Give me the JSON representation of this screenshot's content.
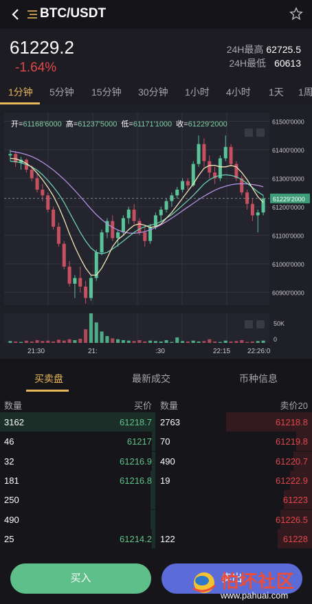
{
  "header": {
    "title": "BTC/USDT"
  },
  "ticker": {
    "last_price": "61229.2",
    "change_pct": "-1.64%",
    "high_label": "24H最高",
    "high_value": "62725.5",
    "low_label": "24H最低",
    "low_value": "60613"
  },
  "timeframes": [
    {
      "label": "1分钟",
      "active": true
    },
    {
      "label": "5分钟",
      "active": false
    },
    {
      "label": "15分钟",
      "active": false
    },
    {
      "label": "30分钟",
      "active": false
    },
    {
      "label": "1小时",
      "active": false
    },
    {
      "label": "4小时",
      "active": false
    },
    {
      "label": "1天",
      "active": false
    },
    {
      "label": "1周",
      "active": false
    }
  ],
  "ohlc": {
    "open_label": "开=",
    "open": "61168'6000",
    "high_label": "高=",
    "high": "61237'5000",
    "low_label": "低=",
    "low": "61171'1000",
    "close_label": "收=",
    "close": "61229'2000"
  },
  "chart_data": {
    "type": "candlestick",
    "y_ticks": [
      "61500'0000",
      "61400'0000",
      "61300'0000",
      "61200'0000",
      "61100'0000",
      "61000'0000",
      "60900'0000"
    ],
    "ylim": [
      60855,
      61530
    ],
    "current_price_label": "61229'2000",
    "current_price": 61229.2,
    "x_ticks": [
      "21:30",
      "21:",
      ":30",
      "22:15",
      "22:26:0"
    ],
    "volume_tick_labels": [
      "50K",
      "0"
    ],
    "volume_max": 65000,
    "colors": {
      "up": "#58c497",
      "down": "#c5505f",
      "ma1": "#f4e6b8",
      "ma2": "#6ecfb0",
      "ma3": "#b48fe0"
    },
    "candles": [
      [
        61380,
        61400,
        61360,
        61385
      ],
      [
        61385,
        61395,
        61340,
        61355
      ],
      [
        61355,
        61375,
        61330,
        61365
      ],
      [
        61365,
        61370,
        61320,
        61330
      ],
      [
        61330,
        61345,
        61290,
        61300
      ],
      [
        61300,
        61320,
        61250,
        61260
      ],
      [
        61260,
        61280,
        61220,
        61240
      ],
      [
        61240,
        61250,
        61180,
        61190
      ],
      [
        61190,
        61200,
        61120,
        61130
      ],
      [
        61130,
        61145,
        61060,
        61070
      ],
      [
        61070,
        61080,
        60980,
        60990
      ],
      [
        60990,
        61010,
        60920,
        60930
      ],
      [
        60930,
        60960,
        60880,
        60950
      ],
      [
        60950,
        60990,
        60900,
        60920
      ],
      [
        60920,
        60940,
        60860,
        60880
      ],
      [
        60880,
        60960,
        60870,
        60950
      ],
      [
        60950,
        61050,
        60940,
        61040
      ],
      [
        61040,
        61120,
        61030,
        61110
      ],
      [
        61110,
        61160,
        61090,
        61150
      ],
      [
        61150,
        61170,
        61080,
        61090
      ],
      [
        61090,
        61120,
        61060,
        61110
      ],
      [
        61110,
        61170,
        61100,
        61160
      ],
      [
        61160,
        61200,
        61140,
        61190
      ],
      [
        61190,
        61210,
        61140,
        61150
      ],
      [
        61150,
        61160,
        61100,
        61110
      ],
      [
        61110,
        61130,
        61060,
        61080
      ],
      [
        61080,
        61140,
        61070,
        61130
      ],
      [
        61130,
        61180,
        61120,
        61170
      ],
      [
        61170,
        61200,
        61150,
        61190
      ],
      [
        61190,
        61230,
        61180,
        61220
      ],
      [
        61220,
        61250,
        61200,
        61240
      ],
      [
        61240,
        61270,
        61230,
        61260
      ],
      [
        61260,
        61300,
        61250,
        61290
      ],
      [
        61290,
        61300,
        61260,
        61275
      ],
      [
        61275,
        61360,
        61270,
        61350
      ],
      [
        61350,
        61450,
        61340,
        61420
      ],
      [
        61420,
        61440,
        61340,
        61360
      ],
      [
        61360,
        61380,
        61300,
        61320
      ],
      [
        61320,
        61340,
        61280,
        61300
      ],
      [
        61300,
        61380,
        61290,
        61370
      ],
      [
        61370,
        61450,
        61360,
        61410
      ],
      [
        61410,
        61420,
        61340,
        61350
      ],
      [
        61350,
        61360,
        61290,
        61300
      ],
      [
        61300,
        61310,
        61240,
        61250
      ],
      [
        61250,
        61260,
        61190,
        61210
      ],
      [
        61210,
        61230,
        61150,
        61170
      ],
      [
        61170,
        61190,
        61110,
        61180
      ],
      [
        61180,
        61240,
        61170,
        61229
      ]
    ],
    "ma1": [
      61370,
      61368,
      61362,
      61352,
      61338,
      61318,
      61295,
      61268,
      61238,
      61200,
      61155,
      61105,
      61060,
      61020,
      60985,
      60960,
      60960,
      60985,
      61020,
      61060,
      61085,
      61100,
      61120,
      61135,
      61140,
      61135,
      61128,
      61130,
      61140,
      61160,
      61180,
      61205,
      61230,
      61255,
      61280,
      61310,
      61335,
      61345,
      61345,
      61340,
      61340,
      61345,
      61340,
      61320,
      61295,
      61265,
      61235,
      61215
    ],
    "ma2": [
      61360,
      61358,
      61354,
      61348,
      61340,
      61328,
      61312,
      61292,
      61270,
      61245,
      61215,
      61180,
      61145,
      61110,
      61080,
      61055,
      61040,
      61035,
      61040,
      61052,
      61065,
      61080,
      61095,
      61110,
      61122,
      61130,
      61135,
      61140,
      61148,
      61160,
      61172,
      61188,
      61205,
      61222,
      61240,
      61260,
      61280,
      61295,
      61305,
      61310,
      61312,
      61310,
      61305,
      61295,
      61282,
      61268,
      61252,
      61240
    ],
    "ma3": [
      61395,
      61392,
      61388,
      61383,
      61376,
      61367,
      61356,
      61343,
      61329,
      61313,
      61296,
      61277,
      61257,
      61236,
      61214,
      61192,
      61172,
      61155,
      61140,
      61128,
      61118,
      61112,
      61108,
      61107,
      61109,
      61113,
      61119,
      61127,
      61137,
      61148,
      61160,
      61173,
      61186,
      61199,
      61212,
      61225,
      61237,
      61248,
      61258,
      61266,
      61272,
      61277,
      61280,
      61281,
      61280,
      61278,
      61275,
      61270
    ],
    "volume": [
      4000,
      3000,
      2000,
      5000,
      3000,
      6000,
      4000,
      5000,
      3000,
      7000,
      5000,
      8000,
      6000,
      9000,
      30000,
      65000,
      45000,
      25000,
      15000,
      10000,
      8000,
      6000,
      5000,
      4000,
      6000,
      3000,
      5000,
      4000,
      3000,
      6000,
      2000,
      12000,
      4000,
      3000,
      5000,
      3000,
      4000,
      8000,
      3000,
      2000,
      5000,
      3000,
      4000,
      6000,
      2000,
      3000,
      4000,
      5000
    ]
  },
  "section_tabs": [
    {
      "label": "买卖盘",
      "active": true
    },
    {
      "label": "最新成交",
      "active": false
    },
    {
      "label": "币种信息",
      "active": false
    }
  ],
  "orderbook": {
    "headers": {
      "bid_qty": "数量",
      "bid_price": "买价",
      "ask_qty": "数量",
      "ask_price": "卖价20"
    },
    "rows": [
      {
        "bid_qty": "3162",
        "bid_price": "61218.7",
        "ask_qty": "2763",
        "ask_price": "61218.8",
        "bid_depth": 1.0,
        "ask_depth": 0.55
      },
      {
        "bid_qty": "46",
        "bid_price": "61217",
        "ask_qty": "70",
        "ask_price": "61219.8",
        "bid_depth": 0.02,
        "ask_depth": 0.1
      },
      {
        "bid_qty": "32",
        "bid_price": "61216.9",
        "ask_qty": "490",
        "ask_price": "61220.7",
        "bid_depth": 0.02,
        "ask_depth": 0.12
      },
      {
        "bid_qty": "181",
        "bid_price": "61216.8",
        "ask_qty": "19",
        "ask_price": "61222.9",
        "bid_depth": 0.03,
        "ask_depth": 0.14
      },
      {
        "bid_qty": "250",
        "bid_price": "",
        "ask_qty": "",
        "ask_price": "61223",
        "bid_depth": 0.03,
        "ask_depth": 0.18
      },
      {
        "bid_qty": "490",
        "bid_price": "",
        "ask_qty": "",
        "ask_price": "61226.5",
        "bid_depth": 0.03,
        "ask_depth": 0.2
      },
      {
        "bid_qty": "25",
        "bid_price": "61214.2",
        "ask_qty": "122",
        "ask_price": "61228",
        "bid_depth": 0.02,
        "ask_depth": 0.22
      }
    ]
  },
  "actions": {
    "buy_label": "买入",
    "sell_label": "卖出"
  },
  "watermark": {
    "text": "怕坏社区",
    "url": "www.pahuai.com"
  }
}
